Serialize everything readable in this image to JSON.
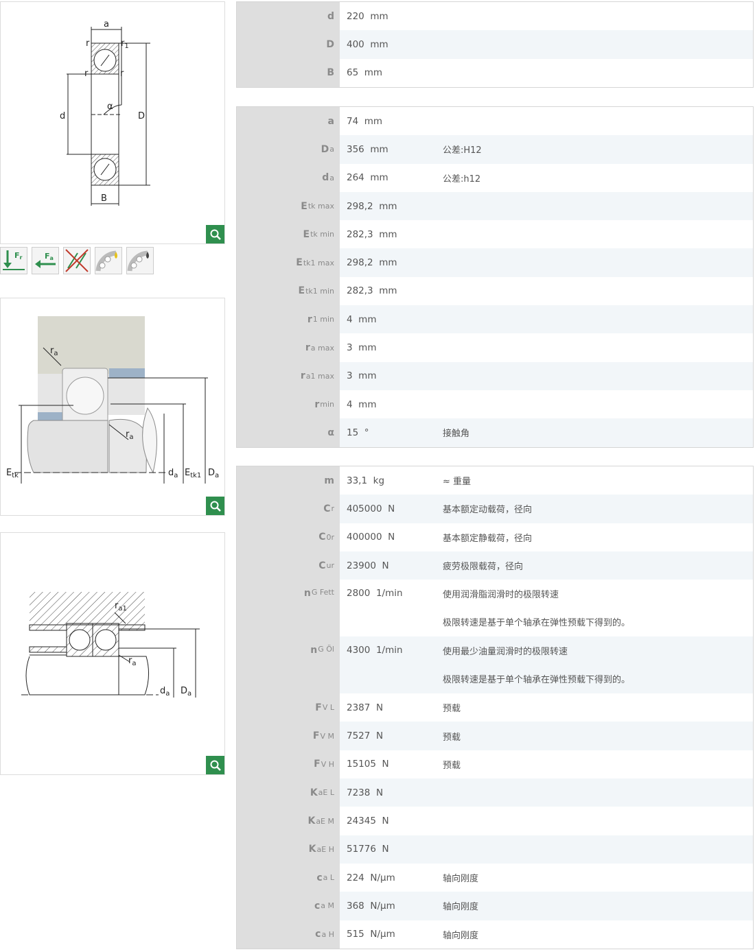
{
  "drawing_labels": {
    "d1": {
      "a": "a",
      "r": "r",
      "r1": "r",
      "r1_sub": "1",
      "d": "d",
      "D": "D",
      "alpha": "α",
      "B": "B"
    },
    "d2": {
      "ra": "r",
      "ra_sub": "a",
      "ra2": "r",
      "ra2_sub": "a",
      "Etk": "E",
      "Etk_sub": "tk",
      "da": "d",
      "da_sub": "a",
      "Etk1": "E",
      "Etk1_sub": "tk1",
      "Da": "D",
      "Da_sub": "a"
    },
    "d3": {
      "ra1": "r",
      "ra1_sub": "a1",
      "ra": "r",
      "ra_sub": "a",
      "da": "d",
      "da_sub": "a",
      "Da": "D",
      "Da_sub": "a"
    }
  },
  "icons": {
    "fr": "F",
    "fr_sub": "r",
    "fa": "F",
    "fa_sub": "a",
    "names": [
      "radial-load-icon",
      "axial-load-icon",
      "no-combination-icon",
      "grease-lubrication-icon",
      "oil-lubrication-icon"
    ]
  },
  "table1": [
    {
      "sym": "d",
      "sub": "",
      "val": "220  mm",
      "desc": ""
    },
    {
      "sym": "D",
      "sub": "",
      "val": "400  mm",
      "desc": ""
    },
    {
      "sym": "B",
      "sub": "",
      "val": "65  mm",
      "desc": ""
    }
  ],
  "table2": [
    {
      "sym": "a",
      "sub": "",
      "val": "74  mm",
      "desc": ""
    },
    {
      "sym": "D",
      "sub": "a",
      "val": "356  mm",
      "desc": "公差:H12"
    },
    {
      "sym": "d",
      "sub": "a",
      "val": "264  mm",
      "desc": "公差:h12"
    },
    {
      "sym": "E",
      "sub": "tk max",
      "val": "298,2  mm",
      "desc": ""
    },
    {
      "sym": "E",
      "sub": "tk min",
      "val": "282,3  mm",
      "desc": ""
    },
    {
      "sym": "E",
      "sub": "tk1 max",
      "val": "298,2  mm",
      "desc": ""
    },
    {
      "sym": "E",
      "sub": "tk1 min",
      "val": "282,3  mm",
      "desc": ""
    },
    {
      "sym": "r",
      "sub": "1 min",
      "val": "4  mm",
      "desc": ""
    },
    {
      "sym": "r",
      "sub": "a max",
      "val": "3  mm",
      "desc": ""
    },
    {
      "sym": "r",
      "sub": "a1 max",
      "val": "3  mm",
      "desc": ""
    },
    {
      "sym": "r",
      "sub": "min",
      "val": "4  mm",
      "desc": ""
    },
    {
      "sym": "α",
      "sub": "",
      "val": "15  °",
      "desc": "接触角"
    }
  ],
  "table3": [
    {
      "sym": "m",
      "sub": "",
      "val": "33,1  kg",
      "desc": "≈ 重量"
    },
    {
      "sym": "C",
      "sub": "r",
      "val": "405000  N",
      "desc": "基本额定动载荷，径向"
    },
    {
      "sym": "C",
      "sub": "0r",
      "val": "400000  N",
      "desc": "基本额定静载荷，径向"
    },
    {
      "sym": "C",
      "sub": "ur",
      "val": "23900  N",
      "desc": "疲劳极限载荷，径向"
    },
    {
      "sym": "n",
      "sub": "G Fett",
      "val": "2800  1/min",
      "desc": "使用润滑脂润滑时的极限转速",
      "desc2": "极限转速是基于单个轴承在弹性预载下得到的。"
    },
    {
      "sym": "n",
      "sub": "G Öl",
      "val": "4300  1/min",
      "desc": "使用最少油量润滑时的极限转速",
      "desc2": "极限转速是基于单个轴承在弹性预载下得到的。"
    },
    {
      "sym": "F",
      "sub": "V L",
      "val": "2387  N",
      "desc": "预载"
    },
    {
      "sym": "F",
      "sub": "V M",
      "val": "7527  N",
      "desc": "预载"
    },
    {
      "sym": "F",
      "sub": "V H",
      "val": "15105  N",
      "desc": "预载"
    },
    {
      "sym": "K",
      "sub": "aE L",
      "val": "7238  N",
      "desc": ""
    },
    {
      "sym": "K",
      "sub": "aE M",
      "val": "24345  N",
      "desc": ""
    },
    {
      "sym": "K",
      "sub": "aE H",
      "val": "51776  N",
      "desc": ""
    },
    {
      "sym": "c",
      "sub": "a L",
      "val": "224  N/μm",
      "desc": "轴向刚度"
    },
    {
      "sym": "c",
      "sub": "a M",
      "val": "368  N/μm",
      "desc": "轴向刚度"
    },
    {
      "sym": "c",
      "sub": "a H",
      "val": "515  N/μm",
      "desc": "轴向刚度"
    }
  ],
  "colors": {
    "accent": "#2f8f4e",
    "label_bg": "#dedede",
    "row_alt": "#f2f6f9"
  }
}
